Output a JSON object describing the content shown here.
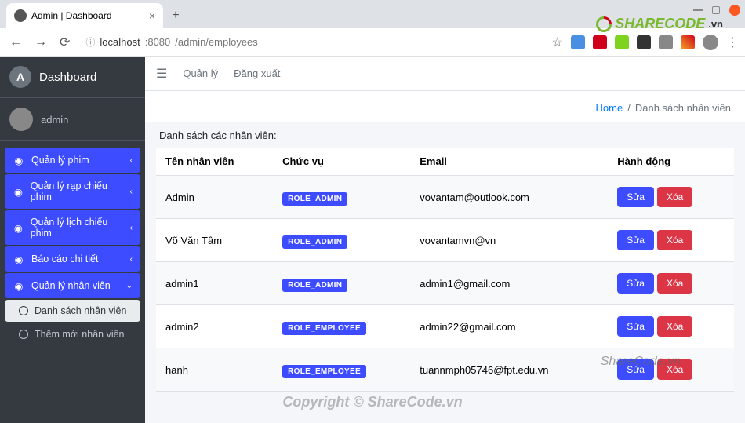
{
  "browser": {
    "tab_title": "Admin | Dashboard",
    "url_host": "localhost",
    "url_port": ":8080",
    "url_path": "/admin/employees"
  },
  "sidebar": {
    "brand": "Dashboard",
    "user": "admin",
    "items": [
      {
        "label": "Quản lý phim",
        "expanded": false
      },
      {
        "label": "Quản lý rạp chiếu phim",
        "expanded": false
      },
      {
        "label": "Quản lý lịch chiếu phim",
        "expanded": false
      },
      {
        "label": "Báo cáo chi tiết",
        "expanded": false
      },
      {
        "label": "Quản lý nhân viên",
        "expanded": true
      }
    ],
    "sub_items": [
      {
        "label": "Danh sách nhân viên",
        "active": true
      },
      {
        "label": "Thêm mới nhân viên",
        "active": false
      }
    ]
  },
  "topbar": {
    "link1": "Quản lý",
    "link2": "Đăng xuất"
  },
  "breadcrumb": {
    "home": "Home",
    "current": "Danh sách nhân viên"
  },
  "content": {
    "list_title": "Danh sách các nhân viên:",
    "columns": {
      "name": "Tên nhân viên",
      "role": "Chức vụ",
      "email": "Email",
      "actions": "Hành động"
    },
    "actions": {
      "edit": "Sửa",
      "delete": "Xóa"
    },
    "rows": [
      {
        "name": "Admin",
        "role": "ROLE_ADMIN",
        "email": "vovantam@outlook.com"
      },
      {
        "name": "Võ Văn Tâm",
        "role": "ROLE_ADMIN",
        "email": "vovantamvn@vn"
      },
      {
        "name": "admin1",
        "role": "ROLE_ADMIN",
        "email": "admin1@gmail.com"
      },
      {
        "name": "admin2",
        "role": "ROLE_EMPLOYEE",
        "email": "admin22@gmail.com"
      },
      {
        "name": "hanh",
        "role": "ROLE_EMPLOYEE",
        "email": "tuannmph05746@fpt.edu.vn"
      }
    ]
  },
  "watermarks": {
    "logo": "SHARECODE",
    "logo_suffix": ".vn",
    "mid": "ShareCode.vn",
    "bottom": "Copyright © ShareCode.vn"
  }
}
